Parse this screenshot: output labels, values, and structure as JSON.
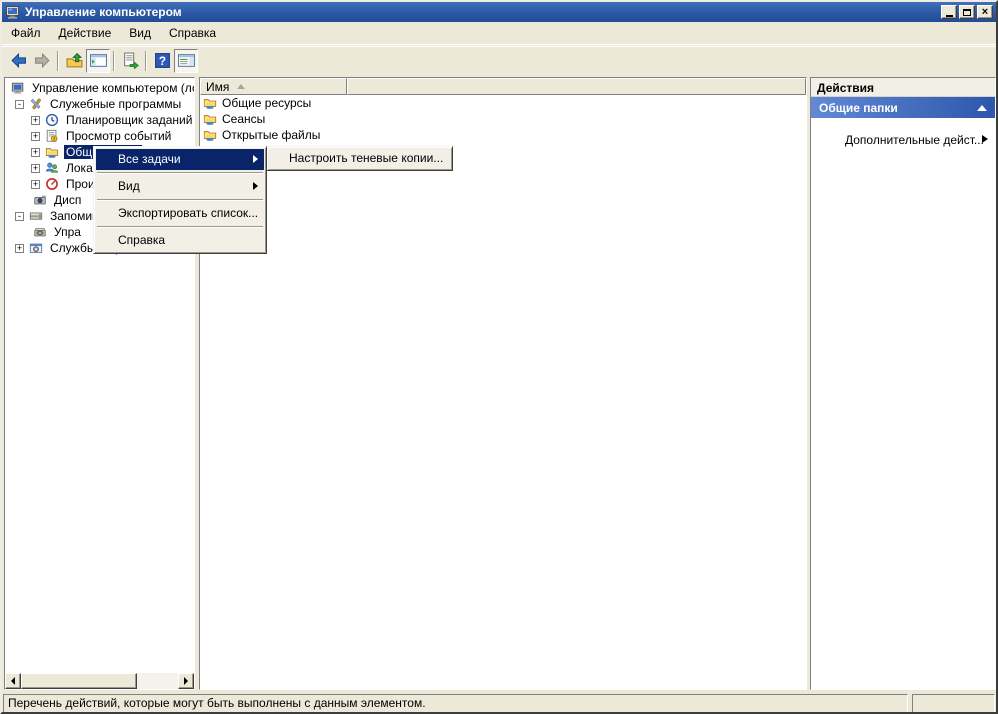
{
  "window": {
    "title": "Управление компьютером",
    "close_glyph": "×"
  },
  "colors": {
    "titlebar_top": "#3F70B8",
    "titlebar_bottom": "#234C97",
    "selection": "#0A246A",
    "chrome": "#ECE9D8",
    "action_header_left": "#6289D6",
    "action_header_right": "#2D57AC"
  },
  "menu_bar": {
    "items": [
      {
        "label": "Файл"
      },
      {
        "label": "Действие"
      },
      {
        "label": "Вид"
      },
      {
        "label": "Справка"
      }
    ]
  },
  "toolbar": {
    "help_glyph": "?"
  },
  "icons": {
    "plus": "+",
    "minus": "-"
  },
  "tree": {
    "items": [
      {
        "label": "Управление компьютером (лока",
        "icon": "computer-icon"
      },
      {
        "label": "Служебные программы",
        "icon": "tools-icon"
      },
      {
        "label": "Планировщик заданий",
        "icon": "scheduler-icon"
      },
      {
        "label": "Просмотр событий",
        "icon": "event-viewer-icon"
      },
      {
        "label": "Общие папки",
        "icon": "shared-folder-icon",
        "selected": true
      },
      {
        "label": "Лока",
        "icon": "users-icon"
      },
      {
        "label": "Прои",
        "icon": "performance-icon"
      },
      {
        "label": "Дисп",
        "icon": "device-manager-icon"
      },
      {
        "label": "Запомина",
        "icon": "storage-icon"
      },
      {
        "label": "Упра",
        "icon": "disk-icon"
      },
      {
        "label": "Службы и приложения",
        "icon": "services-icon"
      }
    ]
  },
  "list": {
    "columns": [
      {
        "label": "Имя",
        "sort": "asc"
      },
      {
        "label": ""
      }
    ],
    "items": [
      {
        "label": "Общие ресурсы",
        "icon": "shared-folder-icon"
      },
      {
        "label": "Сеансы",
        "icon": "shared-folder-icon"
      },
      {
        "label": "Открытые файлы",
        "icon": "shared-folder-icon"
      }
    ]
  },
  "actions_pane": {
    "title": "Действия",
    "section_title": "Общие папки",
    "items": [
      {
        "label": "Дополнительные дейст..."
      }
    ]
  },
  "context_menu": {
    "items": [
      {
        "label": "Все задачи",
        "submenu": true,
        "highlighted": true
      },
      {
        "label": "Вид",
        "submenu": true
      },
      {
        "label": "Экспортировать список..."
      },
      {
        "label": "Справка"
      }
    ]
  },
  "submenu": {
    "items": [
      {
        "label": "Настроить теневые копии..."
      }
    ]
  },
  "status_bar": {
    "text": "Перечень действий, которые могут быть выполнены с данным элементом.",
    "side_text": ""
  }
}
